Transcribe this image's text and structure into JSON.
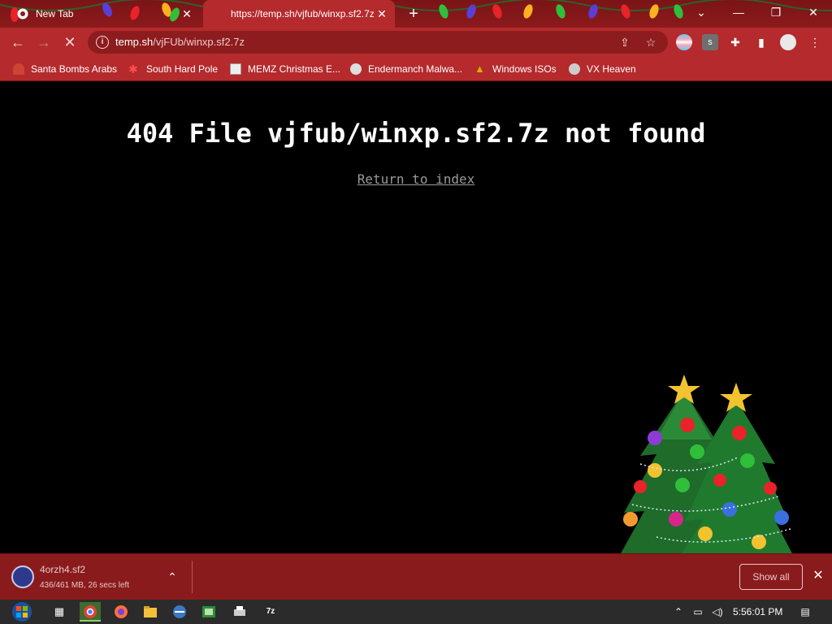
{
  "tabs": [
    {
      "title": "New Tab",
      "active": false
    },
    {
      "title": "https://temp.sh/vjfub/winxp.sf2.7z",
      "active": true
    }
  ],
  "toolbar": {
    "url_host": "temp.sh",
    "url_path": "/vjFUb/winxp.sf2.7z"
  },
  "bookmarks": [
    {
      "label": "Santa Bombs Arabs",
      "icon": "santa-icon"
    },
    {
      "label": "South Hard Pole",
      "icon": "snowflake-icon"
    },
    {
      "label": "MEMZ Christmas E...",
      "icon": "page-icon"
    },
    {
      "label": "Endermanch Malwa...",
      "icon": "wolf-icon"
    },
    {
      "label": "Windows ISOs",
      "icon": "tree-icon"
    },
    {
      "label": "VX Heaven",
      "icon": "ship-icon"
    }
  ],
  "page": {
    "heading": "404 File vjfub/winxp.sf2.7z not found",
    "return_link": "Return to index"
  },
  "download": {
    "filename": "4orzh4.sf2",
    "status": "436/461 MB, 26 secs left",
    "show_all": "Show all"
  },
  "taskbar": {
    "time": "5:56:01 PM",
    "items": [
      "task-view-icon",
      "chrome-icon",
      "firefox-icon",
      "explorer-icon",
      "app-icon",
      "green-app-icon",
      "printer-icon",
      "7zip-icon"
    ],
    "sevenzip_label": "7z"
  },
  "colors": {
    "accent": "#b52a2c",
    "tabstrip": "#7a1416",
    "page_bg": "#000000",
    "link": "#9a9a9a"
  }
}
